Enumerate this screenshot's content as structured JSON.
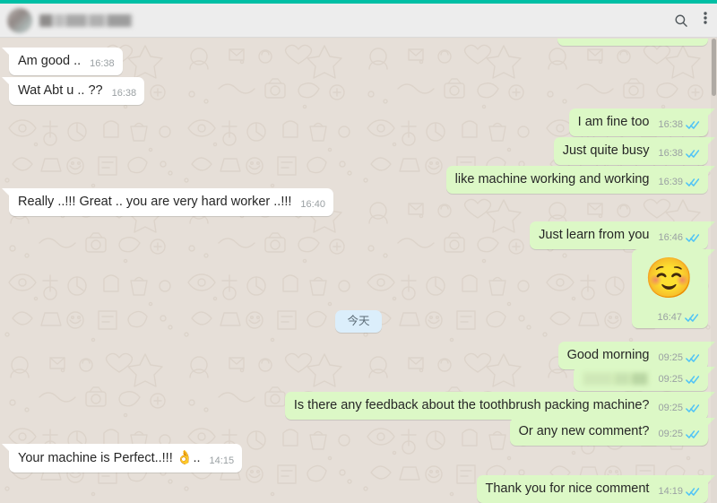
{
  "app": {
    "name": "WhatsApp",
    "accent_teal": "#00bfa5",
    "header_bg": "#ededed",
    "chat_bg": "#e5ddd5",
    "incoming_bubble": "#ffffff",
    "outgoing_bubble": "#dcf8c6",
    "tick_read_color": "#4fc3f7",
    "date_pill_bg": "#dbeefb",
    "timestamp_color": "#9aa0a3"
  },
  "header": {
    "avatar_name": "contact-avatar",
    "contact_name": "",
    "contact_name_redacted": true,
    "search_icon": "search-icon",
    "menu_icon": "overflow-menu-icon"
  },
  "date_divider": {
    "label": "今天"
  },
  "messages": [
    {
      "id": "m0",
      "direction": "out",
      "text": "",
      "time": "",
      "clipped": true,
      "note": "partially scrolled-off outgoing bubble"
    },
    {
      "id": "m1",
      "direction": "in",
      "text": "Am good ..",
      "time": "16:38",
      "status": ""
    },
    {
      "id": "m2",
      "direction": "in",
      "text": "Wat Abt u .. ??",
      "time": "16:38",
      "status": ""
    },
    {
      "id": "m3",
      "direction": "out",
      "text": "I am fine too",
      "time": "16:38",
      "status": "read"
    },
    {
      "id": "m4",
      "direction": "out",
      "text": "Just quite busy",
      "time": "16:38",
      "status": "read"
    },
    {
      "id": "m5",
      "direction": "out",
      "text": "like machine working and working",
      "time": "16:39",
      "status": "read"
    },
    {
      "id": "m6",
      "direction": "in",
      "text": "Really ..!!! Great .. you are very hard worker ..!!!",
      "time": "16:40",
      "status": ""
    },
    {
      "id": "m7",
      "direction": "out",
      "text": "Just learn from you",
      "time": "16:46",
      "status": "read"
    },
    {
      "id": "m8",
      "direction": "out",
      "emoji": "☺️",
      "emoji_name": "relaxed-smiling-face-emoji",
      "text": "",
      "time": "16:47",
      "status": "read"
    },
    {
      "id": "m9",
      "direction": "out",
      "text": "Good morning",
      "time": "09:25",
      "status": "read"
    },
    {
      "id": "m10",
      "direction": "out",
      "text": "",
      "redacted": true,
      "time": "09:25",
      "status": "read"
    },
    {
      "id": "m11",
      "direction": "out",
      "text": "Is there any feedback about the toothbrush packing machine?",
      "time": "09:25",
      "status": "read"
    },
    {
      "id": "m12",
      "direction": "out",
      "text": "Or any new comment?",
      "time": "09:25",
      "status": "read"
    },
    {
      "id": "m13",
      "direction": "in",
      "text_before_emoji": "Your machine is Perfect..!!! ",
      "emoji": "👌",
      "emoji_name": "ok-hand-emoji",
      "text_after_emoji": "..",
      "text": "Your machine is Perfect..!!! 👌..",
      "time": "14:15",
      "status": ""
    },
    {
      "id": "m14",
      "direction": "out",
      "text": "Thank you for nice comment",
      "time": "14:19",
      "status": "read"
    }
  ]
}
